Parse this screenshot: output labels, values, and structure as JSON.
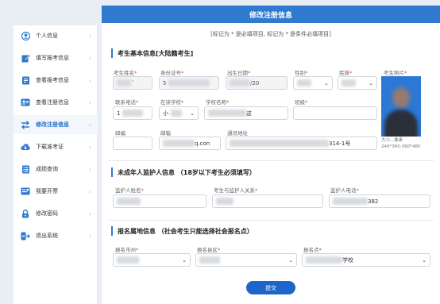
{
  "sidebar": {
    "items": [
      {
        "label": "个人信息",
        "icon": "user-circle-icon",
        "active": false
      },
      {
        "label": "填写报考信息",
        "icon": "edit-icon",
        "active": false
      },
      {
        "label": "查看报考信息",
        "icon": "document-icon",
        "active": false
      },
      {
        "label": "查看注册信息",
        "icon": "id-card-icon",
        "active": false
      },
      {
        "label": "修改注册信息",
        "icon": "swap-arrows-icon",
        "active": true
      },
      {
        "label": "下载准考证",
        "icon": "cloud-download-icon",
        "active": false
      },
      {
        "label": "成绩查询",
        "icon": "list-document-icon",
        "active": false
      },
      {
        "label": "我要开票",
        "icon": "invoice-icon",
        "active": false
      },
      {
        "label": "修改密码",
        "icon": "lock-icon",
        "active": false
      },
      {
        "label": "退出系统",
        "icon": "logout-icon",
        "active": false
      }
    ]
  },
  "header": {
    "title": "修改注册信息"
  },
  "note": "[标记为 * 是必填项目, 标记为 * 是条件必填项目]",
  "sections": {
    "basic": {
      "title": "考生基本信息[大陆籍考生]"
    },
    "guardian": {
      "title": "未成年人监护人信息 （18岁以下考生必须填写）"
    },
    "location": {
      "title": "报名属地信息 （社会考生只能选择社会报名点）"
    }
  },
  "fields": {
    "name": {
      "label": "考生姓名",
      "value": "ˇ"
    },
    "id_number": {
      "label": "身份证号",
      "value": "5"
    },
    "birthdate": {
      "label": "出生日期",
      "value": "/20"
    },
    "gender": {
      "label": "性别",
      "value": ""
    },
    "ethnicity": {
      "label": "民族",
      "value": ""
    },
    "photo": {
      "label": "考生照片",
      "hint_line1": "大小...像素",
      "hint_line2": "240*360-360*480"
    },
    "phone": {
      "label": "联系电话",
      "value": "1"
    },
    "in_school": {
      "label": "在读学校",
      "value": "小"
    },
    "school_name": {
      "label": "学校名称",
      "value": "这"
    },
    "class": {
      "label": "班级",
      "value": ""
    },
    "postcode": {
      "label": "邮编",
      "value": ""
    },
    "email": {
      "label": "邮箱",
      "value": "q.con"
    },
    "address": {
      "label": "通讯地址",
      "value": "314-1号"
    },
    "guardian_name": {
      "label": "监护人姓名",
      "value": ""
    },
    "guardian_relation": {
      "label": "考生与监护人关系",
      "value": ""
    },
    "guardian_phone": {
      "label": "监护人电话",
      "value": "382"
    },
    "reg_city": {
      "label": "报名市州",
      "value": ""
    },
    "reg_county": {
      "label": "报名县区",
      "value": ""
    },
    "reg_point": {
      "label": "报名点",
      "value": "学校"
    }
  },
  "submit_label": "提交",
  "select_arrow": "⌄",
  "chevron": "›",
  "req_mark": "*",
  "colors": {
    "accent": "#2f79cf",
    "required": "#e23a3a",
    "submit": "#1d65c8"
  }
}
